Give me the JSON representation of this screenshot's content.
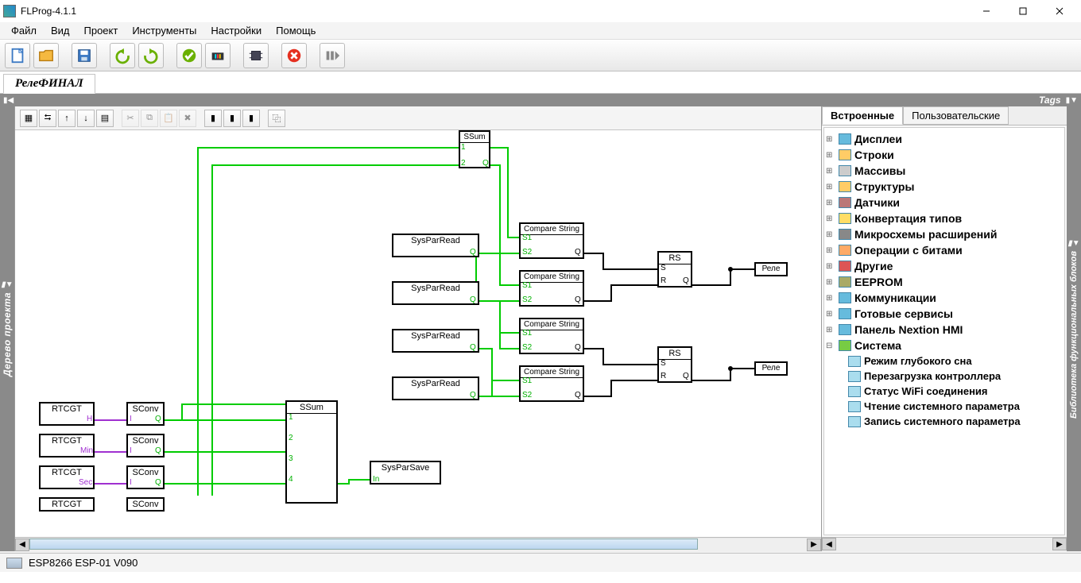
{
  "app": {
    "title": "FLProg-4.1.1"
  },
  "menu": {
    "file": "Файл",
    "view": "Вид",
    "project": "Проект",
    "tools": "Инструменты",
    "settings": "Настройки",
    "help": "Помощь"
  },
  "document_tab": "РелеФИНАЛ",
  "midstrip": {
    "tags": "Tags"
  },
  "left_sidebar_label": "Дерево проекта",
  "right_sidebar_label": "Библиотека функциональных блоков",
  "panel_tabs": {
    "builtin": "Встроенные",
    "user": "Пользовательские"
  },
  "tree": {
    "items": [
      "Дисплеи",
      "Строки",
      "Массивы",
      "Структуры",
      "Датчики",
      "Конвертация типов",
      "Микросхемы расширений",
      "Операции с битами",
      "Другие",
      "EEPROM",
      "Коммуникации",
      "Готовые сервисы",
      "Панель Nextion HMI",
      "Система"
    ],
    "system_children": [
      "Режим глубокого сна",
      "Перезагрузка контроллера",
      "Статус WiFi соединения",
      "Чтение системного параметра",
      "Запись системного параметра"
    ]
  },
  "status": {
    "board": "ESP8266 ESP-01 V090"
  },
  "blocks": {
    "ssum_top": "SSum",
    "syspar_read": "SysParRead",
    "compare_string": "Compare String",
    "rs": "RS",
    "rele": "Реле",
    "rtcgt": "RTCGT",
    "sconv": "SConv",
    "ssum": "SSum",
    "syspar_save": "SysParSave",
    "ports": {
      "q": "Q",
      "s": "S",
      "r": "R",
      "s1": "S1",
      "s2": "S2",
      "in": "In",
      "h": "H",
      "min": "Min",
      "sec": "Sec",
      "n1": "1",
      "n2": "2",
      "n3": "3",
      "n4": "4",
      "i": "I"
    }
  }
}
